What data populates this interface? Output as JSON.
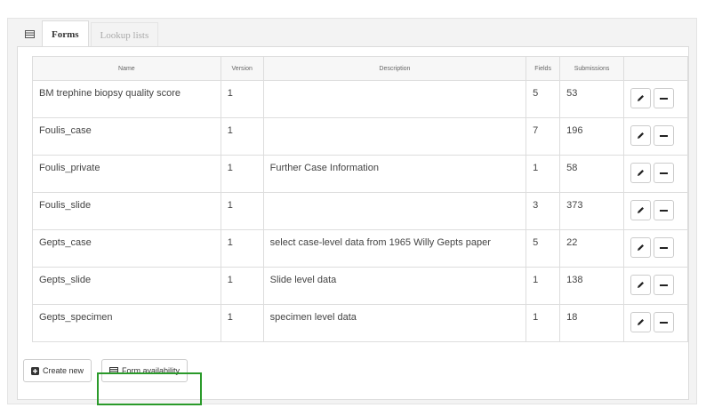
{
  "tabs": [
    {
      "label": "Forms",
      "active": true
    },
    {
      "label": "Lookup lists",
      "active": false
    }
  ],
  "table": {
    "columns": [
      "Name",
      "Version",
      "Description",
      "Fields",
      "Submissions"
    ],
    "rows": [
      {
        "name": "BM trephine biopsy quality score",
        "version": "1",
        "description": "",
        "fields": "5",
        "submissions": "53"
      },
      {
        "name": "Foulis_case",
        "version": "1",
        "description": "",
        "fields": "7",
        "submissions": "196"
      },
      {
        "name": "Foulis_private",
        "version": "1",
        "description": "Further Case Information",
        "fields": "1",
        "submissions": "58"
      },
      {
        "name": "Foulis_slide",
        "version": "1",
        "description": "",
        "fields": "3",
        "submissions": "373"
      },
      {
        "name": "Gepts_case",
        "version": "1",
        "description": "select case-level data from 1965 Willy Gepts paper",
        "fields": "5",
        "submissions": "22"
      },
      {
        "name": "Gepts_slide",
        "version": "1",
        "description": "Slide level data",
        "fields": "1",
        "submissions": "138"
      },
      {
        "name": "Gepts_specimen",
        "version": "1",
        "description": "specimen level data",
        "fields": "1",
        "submissions": "18"
      }
    ]
  },
  "footer": {
    "create_new": "Create new",
    "form_availability": "Form availability"
  },
  "icons": {
    "tab": "table-icon",
    "edit": "pencil-icon",
    "remove": "minus-icon",
    "create": "plus-square-icon",
    "availability": "calendar-icon"
  },
  "colors": {
    "highlight": "#2a9a2a"
  }
}
